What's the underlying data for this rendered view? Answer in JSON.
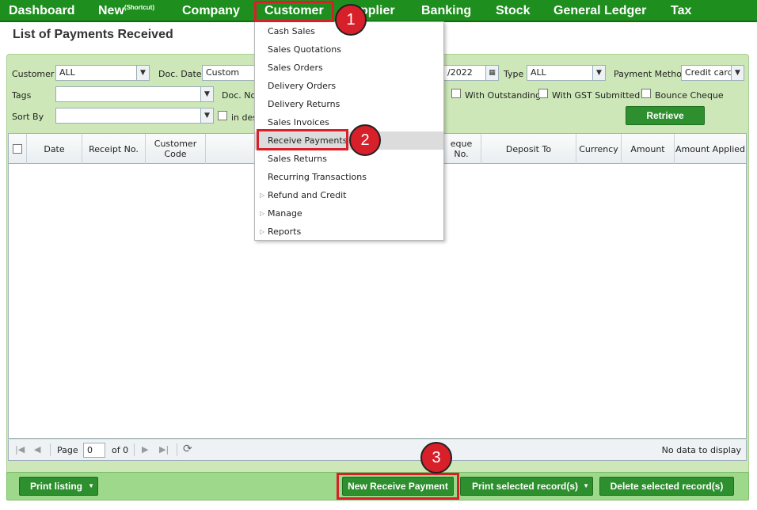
{
  "nav": {
    "dashboard": "Dashboard",
    "new": "New",
    "new_sup": "(Shortcut)",
    "company": "Company",
    "customer": "Customer",
    "supplier": "pplier",
    "banking": "Banking",
    "stock": "Stock",
    "general_ledger": "General Ledger",
    "tax": "Tax"
  },
  "page_title": "List of Payments Received",
  "filters": {
    "customer_label": "Customer",
    "customer_value": "ALL",
    "doc_date_label": "Doc. Date",
    "doc_date_value": "Custom",
    "date_to_value": "/2022",
    "type_label": "Type",
    "type_value": "ALL",
    "payment_method_label": "Payment Method",
    "payment_method_value": "Credit card",
    "tags_label": "Tags",
    "tags_value": "",
    "doc_no_label": "Doc. No.",
    "with_outstanding": "With Outstanding",
    "with_gst_submitted": "With GST Submitted",
    "bounce_cheque": "Bounce Cheque",
    "sort_by_label": "Sort By",
    "sort_by_value": "",
    "in_desc": "in des",
    "retrieve": "Retrieve"
  },
  "grid": {
    "columns": [
      "Date",
      "Receipt No.",
      "Customer Code",
      "eque No.",
      "Deposit To",
      "Currency",
      "Amount",
      "Amount Applied"
    ],
    "rows": []
  },
  "pager": {
    "page_label": "Page",
    "page_value": "0",
    "of_label": "of 0",
    "status": "No data to display"
  },
  "bottom": {
    "print_listing": "Print listing",
    "new_receive_payment": "New Receive Payment",
    "print_selected": "Print selected record(s)",
    "delete_selected": "Delete selected record(s)"
  },
  "menu": {
    "items": [
      {
        "label": "Cash Sales"
      },
      {
        "label": "Sales Quotations"
      },
      {
        "label": "Sales Orders"
      },
      {
        "label": "Delivery Orders"
      },
      {
        "label": "Delivery Returns"
      },
      {
        "label": "Sales Invoices"
      },
      {
        "label": "Receive Payments"
      },
      {
        "label": "Sales Returns"
      },
      {
        "label": "Recurring Transactions"
      },
      {
        "label": "Refund and Credit"
      },
      {
        "label": "Manage"
      },
      {
        "label": "Reports"
      }
    ]
  },
  "annotations": [
    "1",
    "2",
    "3"
  ],
  "colors": {
    "nav_bg": "#1e8e1e",
    "panel_bg": "#cde7b8",
    "button_green": "#2d8f2d",
    "highlight_red": "#d8202a"
  }
}
